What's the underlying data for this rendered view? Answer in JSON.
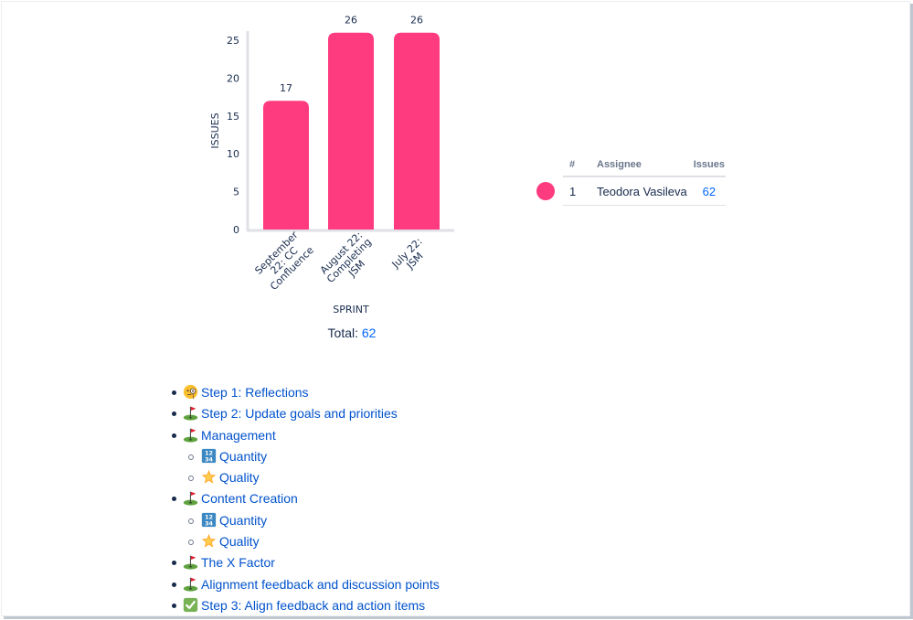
{
  "chart_data": {
    "type": "bar",
    "title": "",
    "xlabel": "SPRINT",
    "ylabel": "ISSUES",
    "categories": [
      [
        "September",
        "22: CC",
        "Confluence"
      ],
      [
        "August 22:",
        "Completing",
        "JSM"
      ],
      [
        "July 22:",
        "JSM"
      ]
    ],
    "category_names": [
      "September 22: CC Confluence",
      "August 22: Completing JSM",
      "July 22: JSM"
    ],
    "values": [
      17,
      26,
      26
    ],
    "data_labels": [
      "17",
      "26",
      "26"
    ],
    "yticks": [
      0,
      5,
      10,
      15,
      20,
      25
    ],
    "ylim": [
      0,
      25
    ],
    "grid": false,
    "bar_color": "#ff3b7f",
    "axis_color": "#dfe1e6"
  },
  "total": {
    "label": "Total:",
    "value": "62"
  },
  "assignee_table": {
    "headers": {
      "num": "#",
      "assignee": "Assignee",
      "issues": "Issues"
    },
    "rows": [
      {
        "num": "1",
        "assignee": "Teodora Vasileva",
        "issues": "62",
        "color": "#ff3b7f"
      }
    ]
  },
  "toc": [
    {
      "label": "Step 1: Reflections",
      "icon": "face-with-monocle-icon",
      "level": 1
    },
    {
      "label": "Step 2: Update goals and priorities",
      "icon": "golf-flag-icon",
      "level": 1
    },
    {
      "label": "Management",
      "icon": "golf-flag-icon",
      "level": 1
    },
    {
      "label": "Quantity",
      "icon": "input-numbers-icon",
      "level": 2
    },
    {
      "label": "Quality",
      "icon": "star-icon",
      "level": 2
    },
    {
      "label": "Content Creation",
      "icon": "golf-flag-icon",
      "level": 1
    },
    {
      "label": "Quantity",
      "icon": "input-numbers-icon",
      "level": 2
    },
    {
      "label": "Quality",
      "icon": "star-icon",
      "level": 2
    },
    {
      "label": "The X Factor",
      "icon": "golf-flag-icon",
      "level": 1
    },
    {
      "label": "Alignment feedback and discussion points",
      "icon": "golf-flag-icon",
      "level": 1
    },
    {
      "label": "Step 3: Align feedback and action items",
      "icon": "check-mark-button-icon",
      "level": 1
    }
  ]
}
